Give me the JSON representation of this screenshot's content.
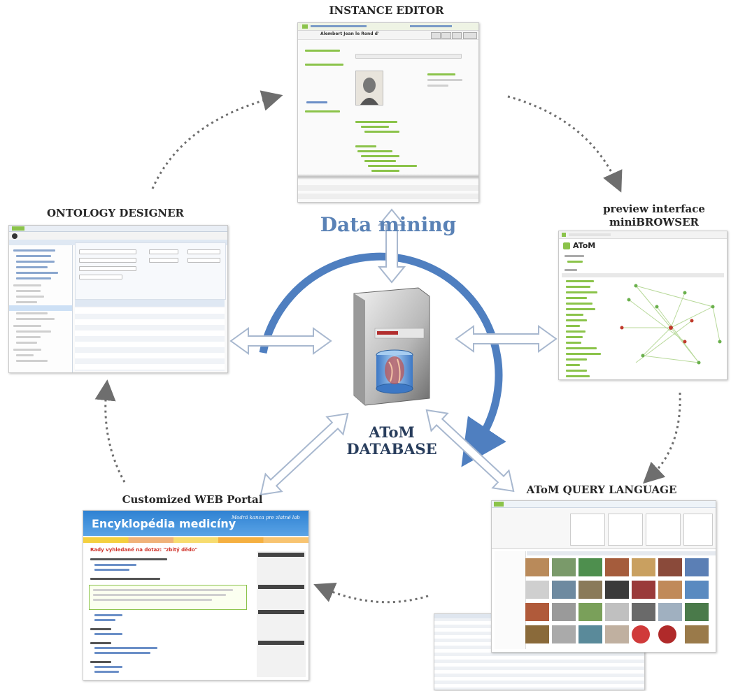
{
  "center_title": "Data mining",
  "database": {
    "name": "AToM",
    "label": "DATABASE"
  },
  "nodes": {
    "instance_editor": {
      "title": "INSTANCE EDITOR",
      "record": "Alembert Jean le Rond d'"
    },
    "ontology_designer": {
      "title": "ONTOLOGY DESIGNER"
    },
    "preview": {
      "title_line1": "preview interface",
      "title_line2": "miniBROWSER",
      "logo": "AToM"
    },
    "query_language": {
      "title": "AToM QUERY LANGUAGE"
    },
    "web_portal": {
      "title": "Customized WEB Portal",
      "banner": "Encyklopédia medicíny",
      "tagline": "Modrá kanca pre zlatné lab",
      "heading": "Rady vyhledané na dotaz: \"zbitý dědo\""
    }
  },
  "colors": {
    "big_arrow": "#4f7fc0",
    "center_title": "#5a82b6",
    "dotted_arrow": "#6e6e6e",
    "double_arrow_outline": "#a8b8cf",
    "portal_banner": "#2f82d2",
    "node_green": "#8bc34a"
  }
}
